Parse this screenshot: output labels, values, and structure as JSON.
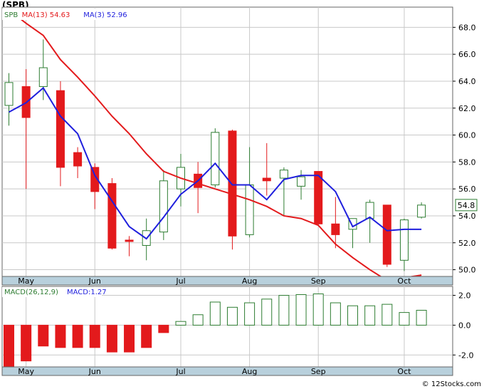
{
  "ticker_label": "(SPB)",
  "watermark": "© 12Stocks.com",
  "colors": {
    "up": "#2e7d32",
    "down": "#e31a1c",
    "ma13": "#e31a1c",
    "ma3": "#1f1fdd",
    "axis_band": "#b8d0dc",
    "grid": "#c8c8c8"
  },
  "chart_data": [
    {
      "type": "candlestick",
      "title": "SPB",
      "legend": [
        {
          "label": "SPB",
          "value": "",
          "color": "#2e7d32"
        },
        {
          "label": "MA(13)",
          "value": "54.63",
          "color": "#e31a1c"
        },
        {
          "label": "MA(3)",
          "value": "52.96",
          "color": "#1f1fdd"
        }
      ],
      "ylim": [
        49.5,
        69.5
      ],
      "y_ticks": [
        50.0,
        52.0,
        54.0,
        56.0,
        58.0,
        60.0,
        62.0,
        64.0,
        66.0,
        68.0
      ],
      "x_labels": [
        {
          "label": "May",
          "i": 1
        },
        {
          "label": "Jun",
          "i": 5
        },
        {
          "label": "Jul",
          "i": 10
        },
        {
          "label": "Aug",
          "i": 14
        },
        {
          "label": "Sep",
          "i": 18
        },
        {
          "label": "Oct",
          "i": 23
        }
      ],
      "candles": [
        {
          "open": 62.2,
          "high": 64.6,
          "low": 60.7,
          "close": 63.9
        },
        {
          "open": 63.6,
          "high": 64.9,
          "low": 56.0,
          "close": 61.3
        },
        {
          "open": 63.6,
          "high": 67.1,
          "low": 62.6,
          "close": 65.0
        },
        {
          "open": 63.3,
          "high": 64.0,
          "low": 56.2,
          "close": 57.6
        },
        {
          "open": 58.7,
          "high": 59.1,
          "low": 56.8,
          "close": 57.7
        },
        {
          "open": 57.6,
          "high": 57.9,
          "low": 54.5,
          "close": 55.8
        },
        {
          "open": 56.4,
          "high": 56.8,
          "low": 51.5,
          "close": 51.6
        },
        {
          "open": 52.2,
          "high": 52.5,
          "low": 51.0,
          "close": 52.1
        },
        {
          "open": 51.8,
          "high": 53.8,
          "low": 50.7,
          "close": 52.9
        },
        {
          "open": 52.8,
          "high": 57.4,
          "low": 52.2,
          "close": 56.6
        },
        {
          "open": 56.0,
          "high": 58.6,
          "low": 54.7,
          "close": 57.6
        },
        {
          "open": 57.1,
          "high": 58.0,
          "low": 54.2,
          "close": 56.1
        },
        {
          "open": 56.3,
          "high": 60.5,
          "low": 56.1,
          "close": 60.2
        },
        {
          "open": 60.3,
          "high": 60.4,
          "low": 51.5,
          "close": 52.5
        },
        {
          "open": 52.6,
          "high": 59.1,
          "low": 52.4,
          "close": 56.3
        },
        {
          "open": 56.8,
          "high": 59.4,
          "low": 55.5,
          "close": 56.6
        },
        {
          "open": 56.8,
          "high": 57.6,
          "low": 54.0,
          "close": 57.4
        },
        {
          "open": 56.2,
          "high": 57.4,
          "low": 55.2,
          "close": 56.9
        },
        {
          "open": 57.3,
          "high": 57.3,
          "low": 53.3,
          "close": 53.4
        },
        {
          "open": 53.4,
          "high": 55.4,
          "low": 51.6,
          "close": 52.6
        },
        {
          "open": 53.0,
          "high": 53.8,
          "low": 51.6,
          "close": 53.8
        },
        {
          "open": 53.8,
          "high": 55.2,
          "low": 52.0,
          "close": 55.0
        },
        {
          "open": 54.8,
          "high": 54.8,
          "low": 50.2,
          "close": 50.4
        },
        {
          "open": 50.7,
          "high": 53.8,
          "low": 49.9,
          "close": 53.7
        },
        {
          "open": 53.9,
          "high": 55.0,
          "low": 53.8,
          "close": 54.8
        }
      ],
      "ma13": [
        {
          "i": 0,
          "v": 69.3
        },
        {
          "i": 1,
          "v": 68.3
        },
        {
          "i": 2,
          "v": 67.4
        },
        {
          "i": 3,
          "v": 65.6
        },
        {
          "i": 4,
          "v": 64.3
        },
        {
          "i": 5,
          "v": 62.9
        },
        {
          "i": 6,
          "v": 61.4
        },
        {
          "i": 7,
          "v": 60.1
        },
        {
          "i": 8,
          "v": 58.6
        },
        {
          "i": 9,
          "v": 57.3
        },
        {
          "i": 10,
          "v": 56.8
        },
        {
          "i": 11,
          "v": 56.4
        },
        {
          "i": 12,
          "v": 56.0
        },
        {
          "i": 13,
          "v": 55.6
        },
        {
          "i": 14,
          "v": 55.2
        },
        {
          "i": 15,
          "v": 54.7
        },
        {
          "i": 16,
          "v": 54.0
        },
        {
          "i": 17,
          "v": 53.8
        },
        {
          "i": 18,
          "v": 53.3
        },
        {
          "i": 19,
          "v": 51.9
        },
        {
          "i": 20,
          "v": 50.9
        },
        {
          "i": 21,
          "v": 50.0
        },
        {
          "i": 22,
          "v": 49.2
        },
        {
          "i": 23,
          "v": 49.4
        },
        {
          "i": 24,
          "v": 49.6
        }
      ],
      "ma3": [
        {
          "i": 0,
          "v": 61.7
        },
        {
          "i": 1,
          "v": 62.4
        },
        {
          "i": 2,
          "v": 63.5
        },
        {
          "i": 3,
          "v": 61.4
        },
        {
          "i": 4,
          "v": 60.1
        },
        {
          "i": 5,
          "v": 57.0
        },
        {
          "i": 6,
          "v": 55.1
        },
        {
          "i": 7,
          "v": 53.2
        },
        {
          "i": 8,
          "v": 52.3
        },
        {
          "i": 9,
          "v": 53.9
        },
        {
          "i": 10,
          "v": 55.6
        },
        {
          "i": 11,
          "v": 56.6
        },
        {
          "i": 12,
          "v": 57.9
        },
        {
          "i": 13,
          "v": 56.3
        },
        {
          "i": 14,
          "v": 56.3
        },
        {
          "i": 15,
          "v": 55.2
        },
        {
          "i": 16,
          "v": 56.7
        },
        {
          "i": 17,
          "v": 57.0
        },
        {
          "i": 18,
          "v": 57.0
        },
        {
          "i": 19,
          "v": 55.8
        },
        {
          "i": 20,
          "v": 53.2
        },
        {
          "i": 21,
          "v": 53.9
        },
        {
          "i": 22,
          "v": 52.9
        },
        {
          "i": 23,
          "v": 53.0
        },
        {
          "i": 24,
          "v": 53.0
        }
      ],
      "last_price": "54.8"
    },
    {
      "type": "bar",
      "title": "MACD(26,12,9)",
      "legend": [
        {
          "label": "MACD(26,12,9)",
          "value": "",
          "color": "#2e7d32"
        },
        {
          "label": "MACD",
          "value": "1.27",
          "color": "#1f1fdd"
        }
      ],
      "ylim": [
        -2.8,
        2.6
      ],
      "y_ticks": [
        2.0,
        0.0,
        -2.0
      ],
      "y_tick_labels": [
        "2.0",
        "0.0",
        "-2.0"
      ],
      "x_labels": [
        {
          "label": "May",
          "i": 1
        },
        {
          "label": "Jun",
          "i": 5
        },
        {
          "label": "Jul",
          "i": 10
        },
        {
          "label": "Aug",
          "i": 14
        },
        {
          "label": "Sep",
          "i": 18
        },
        {
          "label": "Oct",
          "i": 23
        }
      ],
      "values": [
        -2.8,
        -2.4,
        -1.4,
        -1.5,
        -1.5,
        -1.5,
        -1.8,
        -1.8,
        -1.5,
        -0.5,
        0.25,
        0.7,
        1.55,
        1.2,
        1.5,
        1.75,
        2.0,
        2.05,
        2.1,
        1.5,
        1.3,
        1.3,
        1.4,
        0.85,
        1.0,
        1.27
      ]
    }
  ]
}
